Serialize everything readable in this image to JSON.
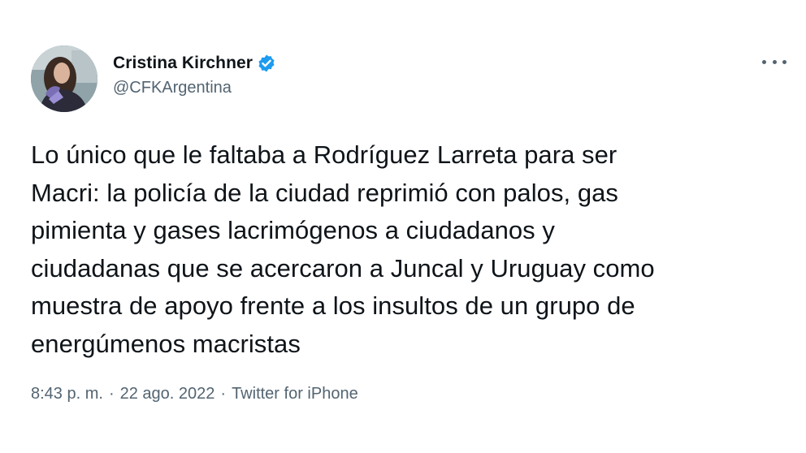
{
  "author": {
    "display_name": "Cristina Kirchner",
    "handle": "@CFKArgentina",
    "verified": true,
    "verified_icon": "verified-badge-icon"
  },
  "tweet": {
    "text": "Lo único que le faltaba a Rodríguez Larreta para ser\nMacri: la policía de la ciudad reprimió con palos, gas\npimienta y gases lacrimógenos a ciudadanos y\nciudadanas que se acercaron a Juncal y Uruguay como\nmuestra de apoyo frente a los insultos de un grupo de\nenergúmenos macristas",
    "time": "8:43 p. m.",
    "date": "22 ago. 2022",
    "separator": "·",
    "source": "Twitter for iPhone"
  },
  "colors": {
    "text_primary": "#0f1419",
    "text_secondary": "#536471",
    "verified_blue": "#1d9bf0"
  },
  "icons": {
    "more": "more-options-icon"
  }
}
